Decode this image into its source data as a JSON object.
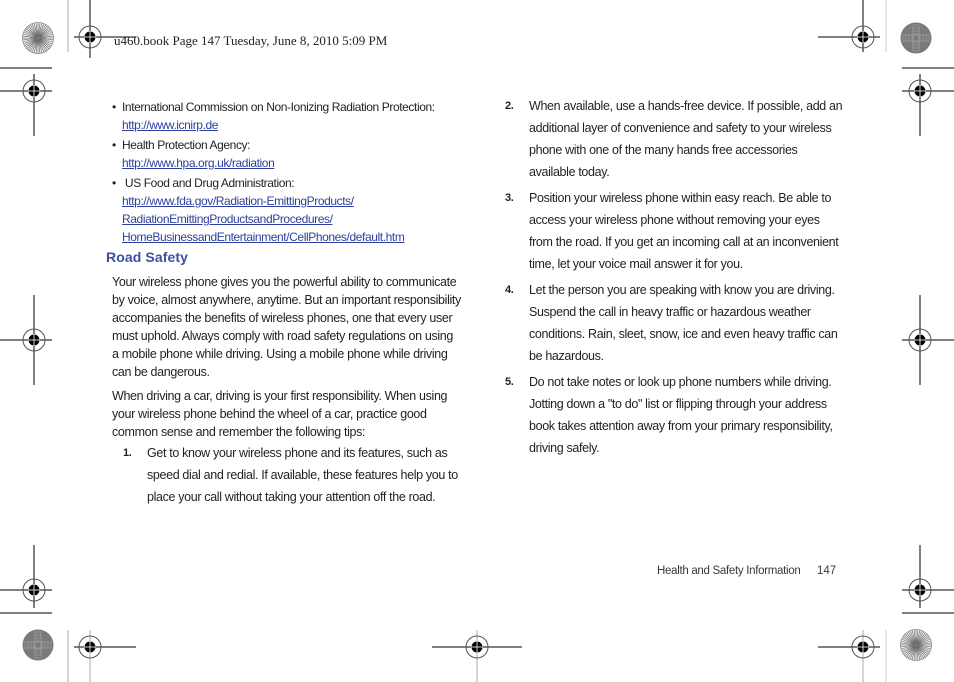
{
  "header": {
    "print_slug": "u460.book  Page 147  Tuesday, June 8, 2010  5:09 PM"
  },
  "resources": [
    {
      "label": "International Commission on Non-Ionizing Radiation Protection:",
      "links": [
        "http://www.icnirp.de"
      ]
    },
    {
      "label": "Health Protection Agency:",
      "links": [
        "http://www.hpa.org.uk/radiation"
      ]
    },
    {
      "label": " US Food and Drug Administration:",
      "links": [
        "http://www.fda.gov/Radiation-EmittingProducts/",
        "RadiationEmittingProductsandProcedures/",
        "HomeBusinessandEntertainment/CellPhones/default.htm"
      ]
    }
  ],
  "bullet_glyph": "•",
  "section": {
    "title": "Road Safety",
    "paragraphs": [
      "Your wireless phone gives you the powerful ability to communicate by voice, almost anywhere, anytime. But an important responsibility accompanies the benefits of wireless phones, one that every user must uphold. Always comply with road safety regulations on using a mobile phone while driving. Using a mobile phone while driving can be dangerous.",
      "When driving a car, driving is your first responsibility. When using your wireless phone behind the wheel of a car, practice good common sense and remember the following tips:"
    ],
    "tips": [
      {
        "num": "1.",
        "text": "Get to know your wireless phone and its features, such as speed dial and redial. If available, these features help you to place your call without taking your attention off the road."
      },
      {
        "num": "2.",
        "text": "When available, use a hands-free device. If possible, add an additional layer of convenience and safety to your wireless phone with one of the many hands free accessories available today."
      },
      {
        "num": "3.",
        "text": "Position your wireless phone within easy reach. Be able to access your wireless phone without removing your eyes from the road. If you get an incoming call at an inconvenient time, let your voice mail answer it for you."
      },
      {
        "num": "4.",
        "text": "Let the person you are speaking with know you are driving. Suspend the call in heavy traffic or hazardous weather conditions. Rain, sleet, snow, ice and even heavy traffic can be hazardous."
      },
      {
        "num": "5.",
        "text": "Do not take notes or look up phone numbers while driving. Jotting down a \"to do\" list or flipping through your address book takes attention away from your primary responsibility, driving safely."
      }
    ]
  },
  "footer": {
    "section_name": "Health and Safety Information",
    "page_number": "147"
  },
  "colors": {
    "heading": "#3a4fa6",
    "link": "#2d3f9e",
    "body_text": "#231f20"
  }
}
